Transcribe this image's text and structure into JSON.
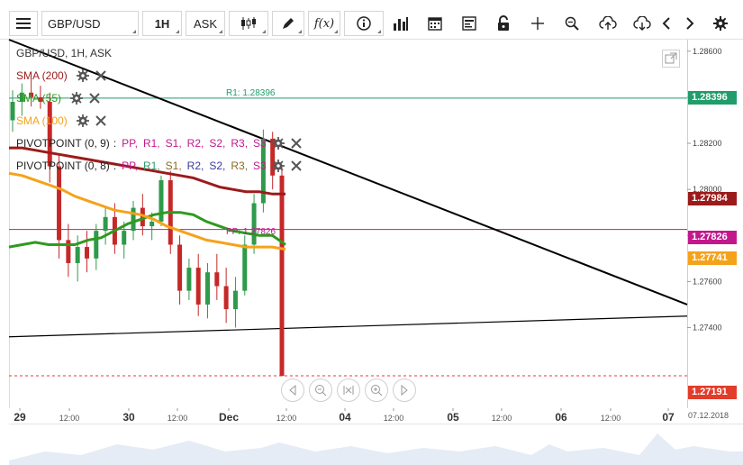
{
  "toolbar": {
    "symbol": "GBP/USD",
    "interval": "1H",
    "price_type": "ASK",
    "icons": [
      "menu-icon",
      "candle-type-icon",
      "draw-pen-icon",
      "fx-icon",
      "info-icon",
      "volume-bars-icon",
      "calendar-icon",
      "template-icon",
      "lock-icon",
      "crosshair-icon",
      "zoom-icon",
      "upload-icon",
      "download-icon",
      "prev-icon",
      "next-icon",
      "settings-icon"
    ],
    "fx_label": "f(x)"
  },
  "chart_header": {
    "title": "GBP/USD, 1H, ASK"
  },
  "indicators": [
    {
      "label": "SMA (200)",
      "color": "#9b1b1b"
    },
    {
      "label": "SMA (55)",
      "color": "#2e9a1f"
    },
    {
      "label": "SMA (100)",
      "color": "#f5a21b"
    }
  ],
  "pivots": [
    {
      "label": "PIVOTPOINT (0, 9)",
      "sep": ":",
      "items": [
        {
          "t": "PP,",
          "c": "#c2188c"
        },
        {
          "t": "R1,",
          "c": "#c2188c"
        },
        {
          "t": "S1,",
          "c": "#c2188c"
        },
        {
          "t": "R2,",
          "c": "#c2188c"
        },
        {
          "t": "S2,",
          "c": "#c2188c"
        },
        {
          "t": "R3,",
          "c": "#c2188c"
        },
        {
          "t": "S3",
          "c": "#c2188c"
        }
      ]
    },
    {
      "label": "PIVOTPOINT (0, 8)",
      "sep": ":",
      "items": [
        {
          "t": "PP,",
          "c": "#c2188c"
        },
        {
          "t": "R1,",
          "c": "#2e9a6f"
        },
        {
          "t": "S1,",
          "c": "#8a6a1f"
        },
        {
          "t": "R2,",
          "c": "#3a3aa0"
        },
        {
          "t": "S2,",
          "c": "#3a3aa0"
        },
        {
          "t": "R3,",
          "c": "#8a6a1f"
        },
        {
          "t": "S3",
          "c": "#c2188c"
        }
      ]
    }
  ],
  "levels": {
    "r1_label": "R1: 1.28396",
    "pp_label": "PP: 1.27826"
  },
  "price_tags": [
    {
      "value": "1.28396",
      "color": "#1f9d6a"
    },
    {
      "value": "1.27984",
      "color": "#9b1b1b"
    },
    {
      "value": "1.27826",
      "color": "#c2188c"
    },
    {
      "value": "1.27741",
      "color": "#f5a21b"
    },
    {
      "value": "1.27191",
      "color": "#e23c2a"
    }
  ],
  "date_badge": "07.12.2018",
  "chart_data": {
    "type": "candlestick",
    "title": "GBP/USD, 1H, ASK",
    "ylim": [
      1.2705,
      1.2865
    ],
    "y_ticks": [
      "1.28600",
      "1.28400",
      "1.28200",
      "1.28000",
      "1.27800",
      "1.27600",
      "1.27400"
    ],
    "x_ticks": [
      {
        "label": "29",
        "major": true
      },
      {
        "label": "12:00",
        "major": false
      },
      {
        "label": "30",
        "major": true
      },
      {
        "label": "12:00",
        "major": false
      },
      {
        "label": "Dec",
        "major": true
      },
      {
        "label": "12:00",
        "major": false
      },
      {
        "label": "04",
        "major": true
      },
      {
        "label": "12:00",
        "major": false
      },
      {
        "label": "05",
        "major": true
      },
      {
        "label": "12:00",
        "major": false
      },
      {
        "label": "06",
        "major": true
      },
      {
        "label": "12:00",
        "major": false
      },
      {
        "label": "07",
        "major": true
      }
    ],
    "horizontal_levels": [
      {
        "name": "R1",
        "value": 1.28396,
        "color": "#1f9d6a"
      },
      {
        "name": "PP",
        "value": 1.27826,
        "color": "#c2188c"
      },
      {
        "name": "last",
        "value": 1.27191,
        "color": "#e23c2a"
      }
    ],
    "trendlines": [
      {
        "from": [
          0,
          1.2865
        ],
        "to": [
          1,
          1.275
        ],
        "color": "#000000"
      },
      {
        "from": [
          0,
          1.2736
        ],
        "to": [
          1,
          1.2745
        ],
        "color": "#000000"
      }
    ],
    "series": [
      {
        "name": "SMA (200)",
        "color": "#9b1b1b",
        "values": [
          1.2818,
          1.2818,
          1.2817,
          1.2816,
          1.2815,
          1.2814,
          1.2813,
          1.2812,
          1.2811,
          1.281,
          1.2809,
          1.2808,
          1.2807,
          1.2806,
          1.2805,
          1.2803,
          1.2801,
          1.28,
          1.2799,
          1.2799,
          1.2798,
          1.2798
        ]
      },
      {
        "name": "SMA (55)",
        "color": "#2e9a1f",
        "values": [
          1.2775,
          1.2776,
          1.2777,
          1.2776,
          1.2776,
          1.2776,
          1.2778,
          1.2779,
          1.2782,
          1.2785,
          1.2787,
          1.2789,
          1.279,
          1.279,
          1.2789,
          1.2786,
          1.2784,
          1.2782,
          1.2781,
          1.278,
          1.278,
          1.2776
        ]
      },
      {
        "name": "SMA (100)",
        "color": "#f5a21b",
        "values": [
          1.2807,
          1.2806,
          1.2804,
          1.2802,
          1.28,
          1.2797,
          1.2795,
          1.2793,
          1.2791,
          1.279,
          1.2789,
          1.2787,
          1.2784,
          1.2782,
          1.278,
          1.2778,
          1.2777,
          1.2776,
          1.2775,
          1.2775,
          1.2775,
          1.2774
        ]
      }
    ],
    "candles": [
      [
        1.283,
        1.2843,
        1.2825,
        1.2838
      ],
      [
        1.2838,
        1.2846,
        1.2832,
        1.2842
      ],
      [
        1.2842,
        1.2848,
        1.2836,
        1.284
      ],
      [
        1.284,
        1.2845,
        1.2835,
        1.2838
      ],
      [
        1.2838,
        1.2842,
        1.2803,
        1.281
      ],
      [
        1.281,
        1.2815,
        1.277,
        1.2778
      ],
      [
        1.2778,
        1.2785,
        1.2762,
        1.2768
      ],
      [
        1.2768,
        1.278,
        1.276,
        1.2775
      ],
      [
        1.2775,
        1.2782,
        1.2764,
        1.277
      ],
      [
        1.277,
        1.2785,
        1.2765,
        1.2782
      ],
      [
        1.2782,
        1.2792,
        1.2776,
        1.2788
      ],
      [
        1.2788,
        1.2794,
        1.2772,
        1.2776
      ],
      [
        1.2776,
        1.2786,
        1.277,
        1.2782
      ],
      [
        1.2782,
        1.2795,
        1.2778,
        1.2792
      ],
      [
        1.2792,
        1.2798,
        1.278,
        1.2784
      ],
      [
        1.2784,
        1.279,
        1.2778,
        1.2786
      ],
      [
        1.2786,
        1.2806,
        1.2784,
        1.2804
      ],
      [
        1.2804,
        1.2808,
        1.2772,
        1.2776
      ],
      [
        1.2776,
        1.278,
        1.275,
        1.2756
      ],
      [
        1.2756,
        1.277,
        1.2752,
        1.2766
      ],
      [
        1.2766,
        1.2772,
        1.2745,
        1.275
      ],
      [
        1.275,
        1.2768,
        1.2744,
        1.2764
      ],
      [
        1.2764,
        1.2772,
        1.2752,
        1.2758
      ],
      [
        1.2758,
        1.2766,
        1.2742,
        1.2748
      ],
      [
        1.2748,
        1.2762,
        1.274,
        1.2756
      ],
      [
        1.2756,
        1.278,
        1.2754,
        1.2776
      ],
      [
        1.2776,
        1.2798,
        1.2772,
        1.2794
      ],
      [
        1.2794,
        1.2826,
        1.279,
        1.2822
      ],
      [
        1.2822,
        1.2825,
        1.28,
        1.2806
      ],
      [
        1.2806,
        1.281,
        1.2719,
        1.2719
      ]
    ]
  }
}
